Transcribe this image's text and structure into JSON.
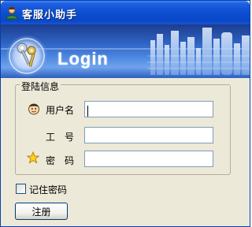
{
  "window": {
    "title": "客服小助手",
    "app_icon": "user-icon"
  },
  "banner": {
    "logo_icon": "keys-icon",
    "heading": "Login"
  },
  "login_group": {
    "legend": "登陆信息",
    "fields": [
      {
        "label": "用户名",
        "icon": "smiley-face-icon",
        "value": ""
      },
      {
        "label": "工　号",
        "icon": "",
        "value": ""
      },
      {
        "label": "密　码",
        "icon": "star-icon",
        "value": ""
      }
    ]
  },
  "remember": {
    "label": "记住密码",
    "checked": false
  },
  "register_button": {
    "label": "注册"
  },
  "colors": {
    "titlebar": "#0c4fd2",
    "banner": "#2f63c4",
    "window_bg": "#ece9d8",
    "field_border": "#7f9db9"
  }
}
